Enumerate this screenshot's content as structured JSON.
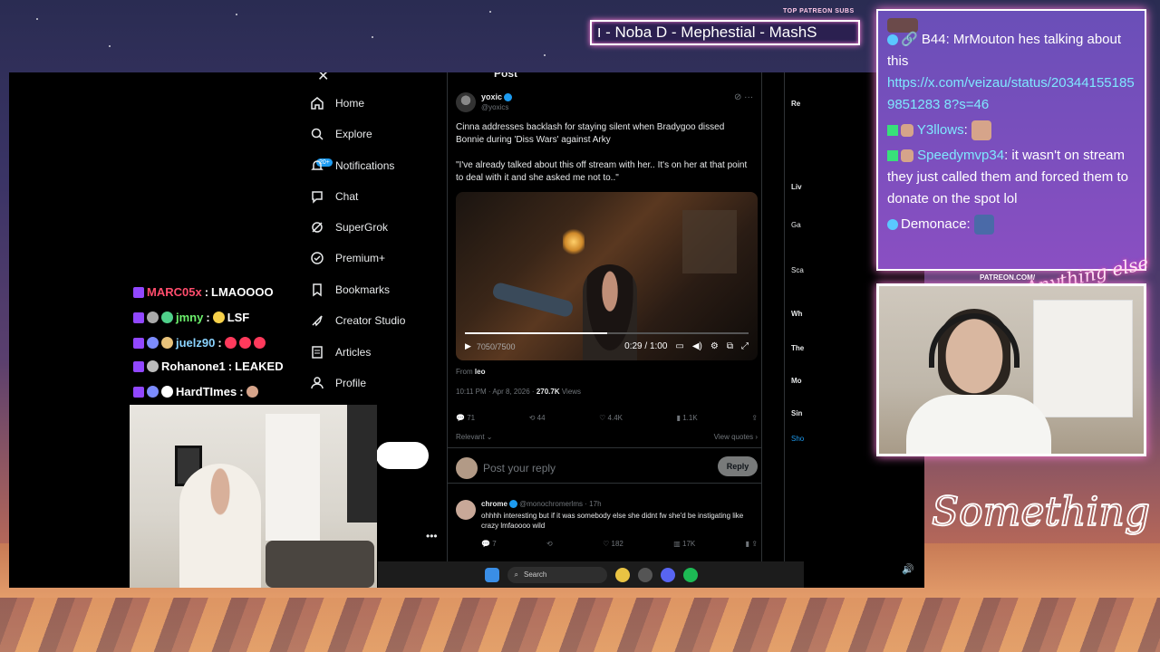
{
  "overlay": {
    "patreon_label": "TOP PATREON SUBS",
    "patreon_ticker": "ו - Noba D - Mephestial - MashS",
    "patreon_url": "PATREON.COM/",
    "brand_top": "Anything else",
    "brand_bottom": "Something else"
  },
  "x_app": {
    "nav": [
      {
        "label": "Home",
        "icon": "home-icon"
      },
      {
        "label": "Explore",
        "icon": "search-icon"
      },
      {
        "label": "Notifications",
        "icon": "bell-icon"
      },
      {
        "label": "Chat",
        "icon": "chat-icon"
      },
      {
        "label": "SuperGrok",
        "icon": "grok-icon"
      },
      {
        "label": "Premium+",
        "icon": "x-premium-icon"
      },
      {
        "label": "Bookmarks",
        "icon": "bookmark-icon"
      },
      {
        "label": "Creator Studio",
        "icon": "rocket-icon"
      },
      {
        "label": "Articles",
        "icon": "article-icon"
      },
      {
        "label": "Profile",
        "icon": "person-icon"
      }
    ],
    "notif_badge": "20+",
    "header_title": "Post",
    "post": {
      "name": "yoxic",
      "handle": "@yoxics",
      "text1": "Cinna addresses backlash for staying silent when Bradygoo dissed Bonnie during 'Diss Wars' against Arky",
      "text2": "\"I've already talked about this off stream with her.. It's on her at that point to deal with it and she asked me not to..\"",
      "video_time": "0:29 / 1:00",
      "video_stats": "7050/7500",
      "from_label": "From",
      "from_value": "leo",
      "timestamp": "10:11 PM · Apr 8, 2026 ·",
      "views_value": "270.7K",
      "views_label": "Views",
      "replies": "71",
      "reposts": "44",
      "likes": "4.4K",
      "bookmarks": "1.1K",
      "sort": "Relevant",
      "view_quotes": "View quotes"
    },
    "reply_placeholder": "Post your reply",
    "reply_button": "Reply",
    "reply2": {
      "name": "chrome",
      "handle": "@monochromerlms · 17h",
      "text": "ohhhh interesting but if it was somebody else she didnt fw she'd be instigating like crazy lmfaoooo wild",
      "replies": "7",
      "likes": "182",
      "views": "17K"
    },
    "right_col": [
      "Re",
      "Liv",
      "Ga",
      "Sca",
      "Wh",
      "The",
      "Mo",
      "Sin",
      "Sho"
    ],
    "taskbar_search": "Search"
  },
  "stream_chat": [
    {
      "user": "MARC05x",
      "msg": "LMAOOOO",
      "color": "#ff4d6d"
    },
    {
      "user": "jmny",
      "msg": "LSF",
      "color": "#6cf06c"
    },
    {
      "user": "juelz90",
      "msg": "",
      "color": "#8ad3ff"
    },
    {
      "user": "Rohanone1",
      "msg": "LEAKED",
      "color": "#ffffff"
    },
    {
      "user": "HardTImes",
      "msg": "",
      "color": "#ffffff"
    }
  ],
  "side_chat": {
    "msg1_user": "B44",
    "msg1_text": "MrMouton hes talking about this",
    "msg1_link": "https://x.com/veizau/status/203441551859851283 8?s=46",
    "msg2_user": "Y3llows",
    "msg3_user": "Speedymvp34",
    "msg3_text": "it wasn't on stream they just called them and forced them to donate on the spot lol",
    "msg4_user": "Demonace"
  },
  "colors": {
    "x_blue": "#1d9bf0",
    "twitch_purple": "#9147ff",
    "neon_pink": "#ff7ad9"
  }
}
